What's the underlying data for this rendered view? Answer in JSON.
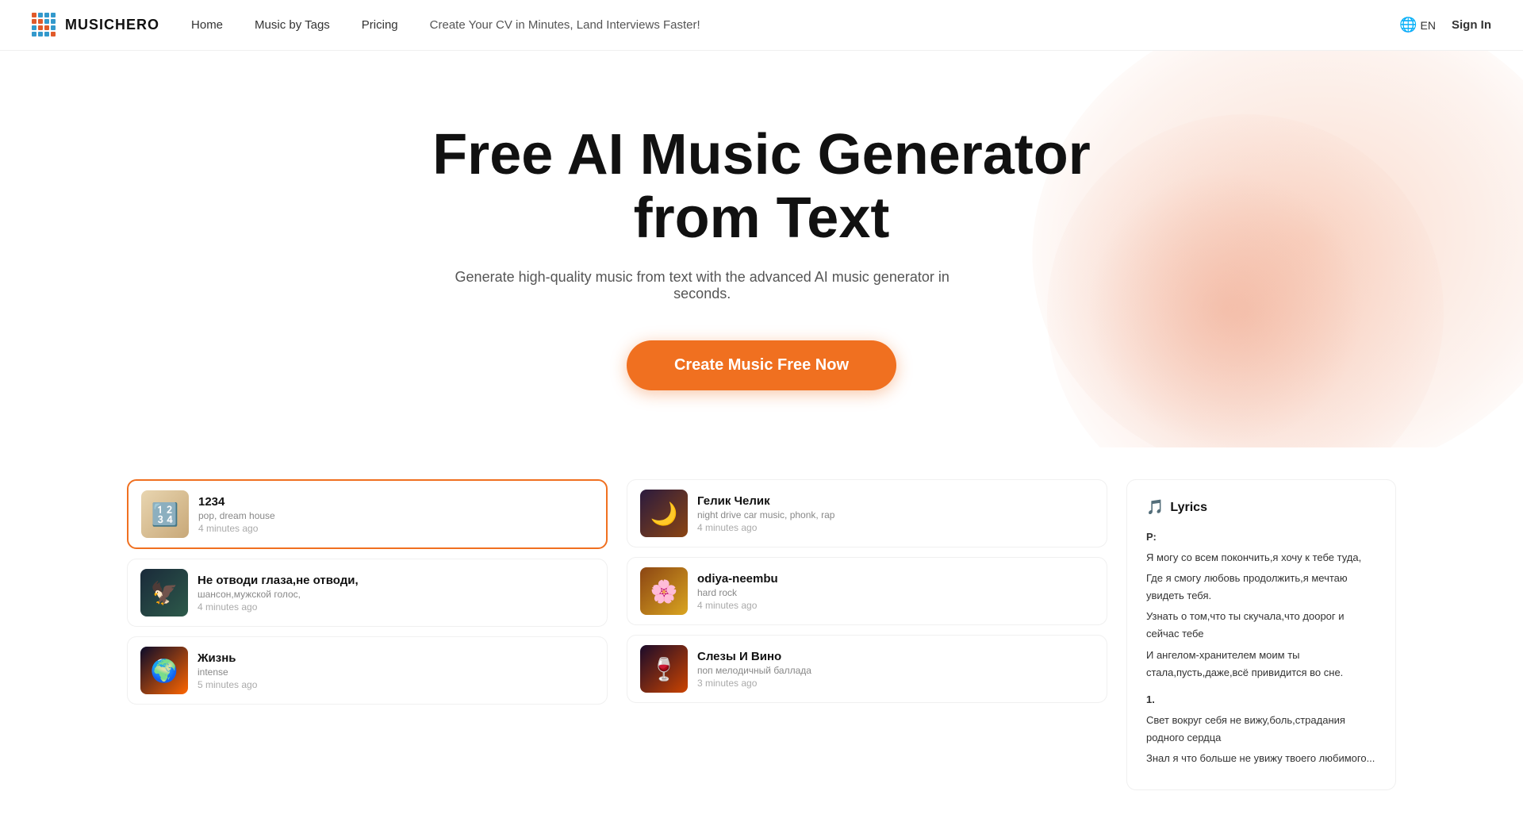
{
  "nav": {
    "logo_text": "MUSICHERO",
    "links": [
      {
        "label": "Home",
        "name": "home"
      },
      {
        "label": "Music by Tags",
        "name": "music-by-tags"
      },
      {
        "label": "Pricing",
        "name": "pricing"
      },
      {
        "label": "Create Your CV in Minutes, Land Interviews Faster!",
        "name": "promo"
      }
    ],
    "lang": "EN",
    "sign_in": "Sign In"
  },
  "hero": {
    "title_line1": "Free AI Music Generator",
    "title_line2": "from Text",
    "subtitle": "Generate high-quality music from text with the advanced AI music generator in seconds.",
    "cta": "Create Music Free Now"
  },
  "music_cards": [
    {
      "id": "1234",
      "title": "1234",
      "tags": "pop, dream house",
      "time": "4 minutes ago",
      "thumb_class": "thumb-1234",
      "active": true,
      "col": 0
    },
    {
      "id": "gelik",
      "title": "Гелик Челик",
      "tags": "night drive car music, phonk, rap",
      "time": "4 minutes ago",
      "thumb_class": "thumb-gelik",
      "active": false,
      "col": 1
    },
    {
      "id": "ne-otvodi",
      "title": "Не отводи глаза,не отводи,",
      "tags": "шансон,мужской голос,",
      "time": "4 minutes ago",
      "thumb_class": "thumb-ne-otvodi",
      "active": false,
      "col": 0
    },
    {
      "id": "odiya",
      "title": "odiya-neembu",
      "tags": "hard rock",
      "time": "4 minutes ago",
      "thumb_class": "thumb-odiya",
      "active": false,
      "col": 1
    },
    {
      "id": "zhizn",
      "title": "Жизнь",
      "tags": "intense",
      "time": "5 minutes ago",
      "thumb_class": "thumb-zhizn",
      "active": false,
      "col": 0
    },
    {
      "id": "slezy",
      "title": "Слезы И Вино",
      "tags": "поп мелодичный баллада",
      "time": "3 minutes ago",
      "thumb_class": "thumb-slezy",
      "active": false,
      "col": 1
    }
  ],
  "lyrics": {
    "header": "Lyrics",
    "section_r": "Р:",
    "lines_r": [
      "Я могу со всем покончить,я хочу к тебе туда,",
      "Где я смогу любовь продолжить,я мечтаю увидеть тебя.",
      "Узнать о том,что ты скучала,что доорог и сейчас тебе",
      "И ангелом-хранителем моим ты стала,пусть,даже,всё привидится во сне."
    ],
    "section_1": "1.",
    "lines_1": [
      "Свет вокруг себя не вижу,боль,страдания родного сердца",
      "Знал я что больше не увижу твоего любимого..."
    ]
  }
}
